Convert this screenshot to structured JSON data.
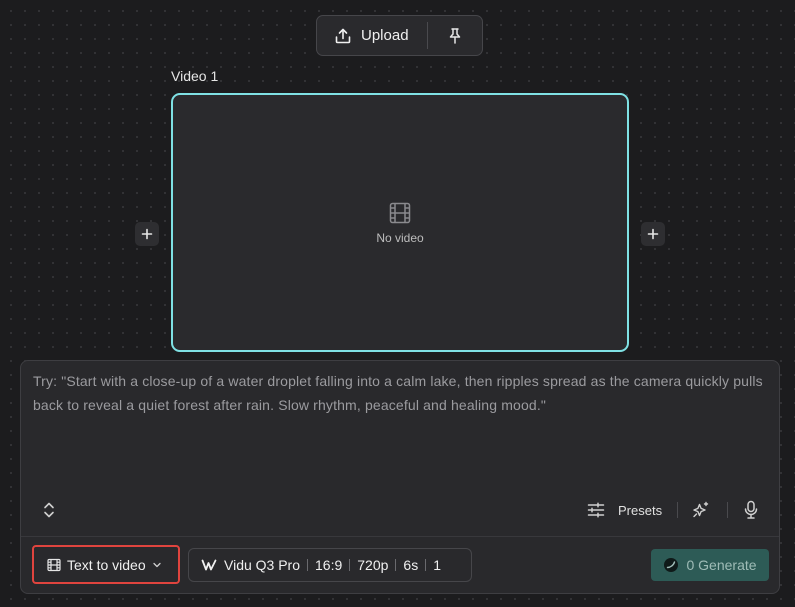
{
  "toolbar": {
    "upload_label": "Upload",
    "upload_icon": "upload-icon",
    "pin_icon": "pin-icon"
  },
  "canvas": {
    "video_label": "Video 1",
    "empty_text": "No video",
    "empty_icon": "film-icon",
    "frame_border_color": "#7fe1e4"
  },
  "prompt": {
    "placeholder": "Try: \"Start with a close-up of a water droplet falling into a calm lake, then ripples spread as the camera quickly pulls back to reveal a quiet forest after rain. Slow rhythm, peaceful and healing mood.\"",
    "presets_label": "Presets"
  },
  "bottom_bar": {
    "mode_label": "Text to video",
    "mode_highlight_color": "#e0443e",
    "model_name": "Vidu Q3 Pro",
    "aspect_ratio": "16:9",
    "resolution": "720p",
    "duration": "6s",
    "count": "1",
    "generate_cost": "0",
    "generate_label": "Generate",
    "generate_color": "#2d5b56"
  }
}
